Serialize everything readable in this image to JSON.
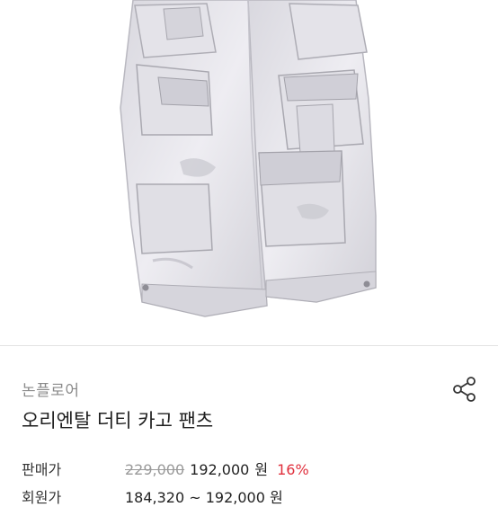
{
  "product": {
    "brand": "논플로어",
    "name": "오리엔탈 더티 카고 팬츠"
  },
  "pricing": {
    "sale_label": "판매가",
    "original_price": "229,000",
    "sale_price": "192,000",
    "currency_unit": "원",
    "discount": "16%",
    "member_label": "회원가",
    "member_price_range": "184,320 ~ 192,000 원"
  },
  "icons": {
    "share": "share-icon"
  },
  "colors": {
    "discount": "#e0303d",
    "original_price": "#9a9a9a",
    "brand": "#8a8a8a"
  }
}
